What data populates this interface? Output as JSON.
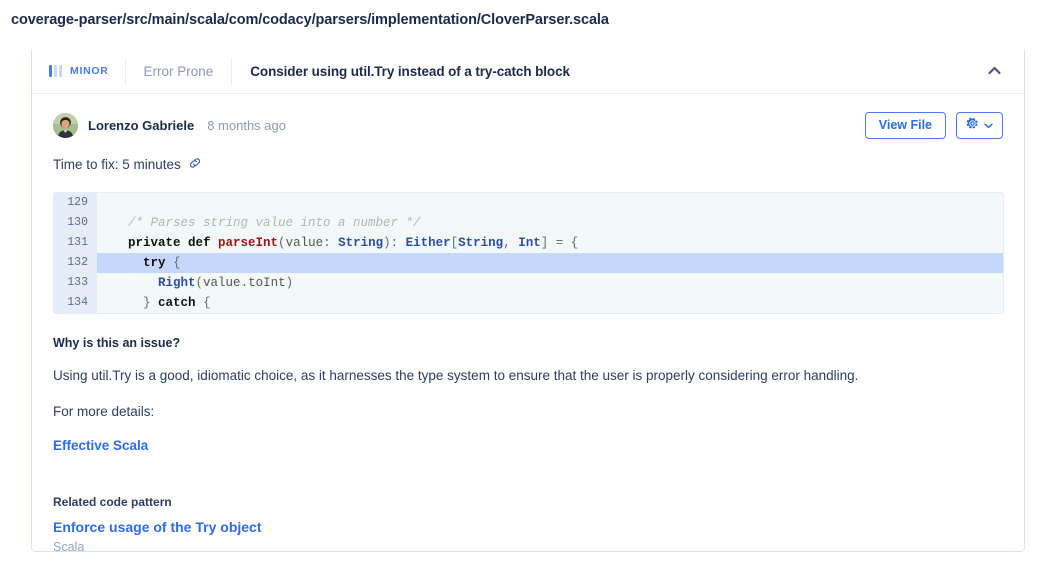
{
  "file_path": "coverage-parser/src/main/scala/com/codacy/parsers/implementation/CloverParser.scala",
  "issue": {
    "severity_label": "MINOR",
    "severity_level": 1,
    "category": "Error Prone",
    "title": "Consider using util.Try instead of a try-catch block",
    "collapse_icon": "chevron-up-icon",
    "accent_color": "#5c8df6"
  },
  "meta": {
    "author": "Lorenzo Gabriele",
    "timestamp": "8 months ago",
    "view_file_label": "View File",
    "settings_icon": "gear-icon",
    "settings_chevron": "chevron-down-icon",
    "time_to_fix": "Time to fix: 5 minutes",
    "link_icon": "chain-link-icon"
  },
  "code": {
    "lines": [
      {
        "number": "129",
        "highlight": false,
        "tokens": []
      },
      {
        "number": "130",
        "highlight": false,
        "tokens": [
          {
            "t": "  ",
            "c": "tok-punc"
          },
          {
            "t": "/* Parses string value into a number */",
            "c": "tok-com"
          }
        ]
      },
      {
        "number": "131",
        "highlight": false,
        "tokens": [
          {
            "t": "  ",
            "c": "tok-punc"
          },
          {
            "t": "private def ",
            "c": "tok-kw"
          },
          {
            "t": "parseInt",
            "c": "tok-fn"
          },
          {
            "t": "(",
            "c": "tok-punc"
          },
          {
            "t": "value",
            "c": "tok-id"
          },
          {
            "t": ": ",
            "c": "tok-punc"
          },
          {
            "t": "String",
            "c": "tok-type"
          },
          {
            "t": "): ",
            "c": "tok-punc"
          },
          {
            "t": "Either",
            "c": "tok-type"
          },
          {
            "t": "[",
            "c": "tok-punc"
          },
          {
            "t": "String",
            "c": "tok-type"
          },
          {
            "t": ", ",
            "c": "tok-punc"
          },
          {
            "t": "Int",
            "c": "tok-type"
          },
          {
            "t": "] = {",
            "c": "tok-punc"
          }
        ]
      },
      {
        "number": "132",
        "highlight": true,
        "tokens": [
          {
            "t": "    ",
            "c": "tok-punc"
          },
          {
            "t": "try",
            "c": "tok-kw"
          },
          {
            "t": " {",
            "c": "tok-punc"
          }
        ]
      },
      {
        "number": "133",
        "highlight": false,
        "tokens": [
          {
            "t": "      ",
            "c": "tok-punc"
          },
          {
            "t": "Right",
            "c": "tok-type"
          },
          {
            "t": "(",
            "c": "tok-punc"
          },
          {
            "t": "value",
            "c": "tok-id"
          },
          {
            "t": ".",
            "c": "tok-punc"
          },
          {
            "t": "toInt",
            "c": "tok-id"
          },
          {
            "t": ")",
            "c": "tok-punc"
          }
        ]
      },
      {
        "number": "134",
        "highlight": false,
        "tokens": [
          {
            "t": "    } ",
            "c": "tok-punc"
          },
          {
            "t": "catch",
            "c": "tok-kw"
          },
          {
            "t": " {",
            "c": "tok-punc"
          }
        ]
      }
    ]
  },
  "explanation": {
    "heading": "Why is this an issue?",
    "body": "Using util.Try is a good, idiomatic choice, as it harnesses the type system to ensure that the user is properly considering error handling.",
    "more_details_label": "For more details:",
    "reference_link": "Effective Scala"
  },
  "related": {
    "heading": "Related code pattern",
    "link": "Enforce usage of the Try object",
    "language": "Scala"
  }
}
